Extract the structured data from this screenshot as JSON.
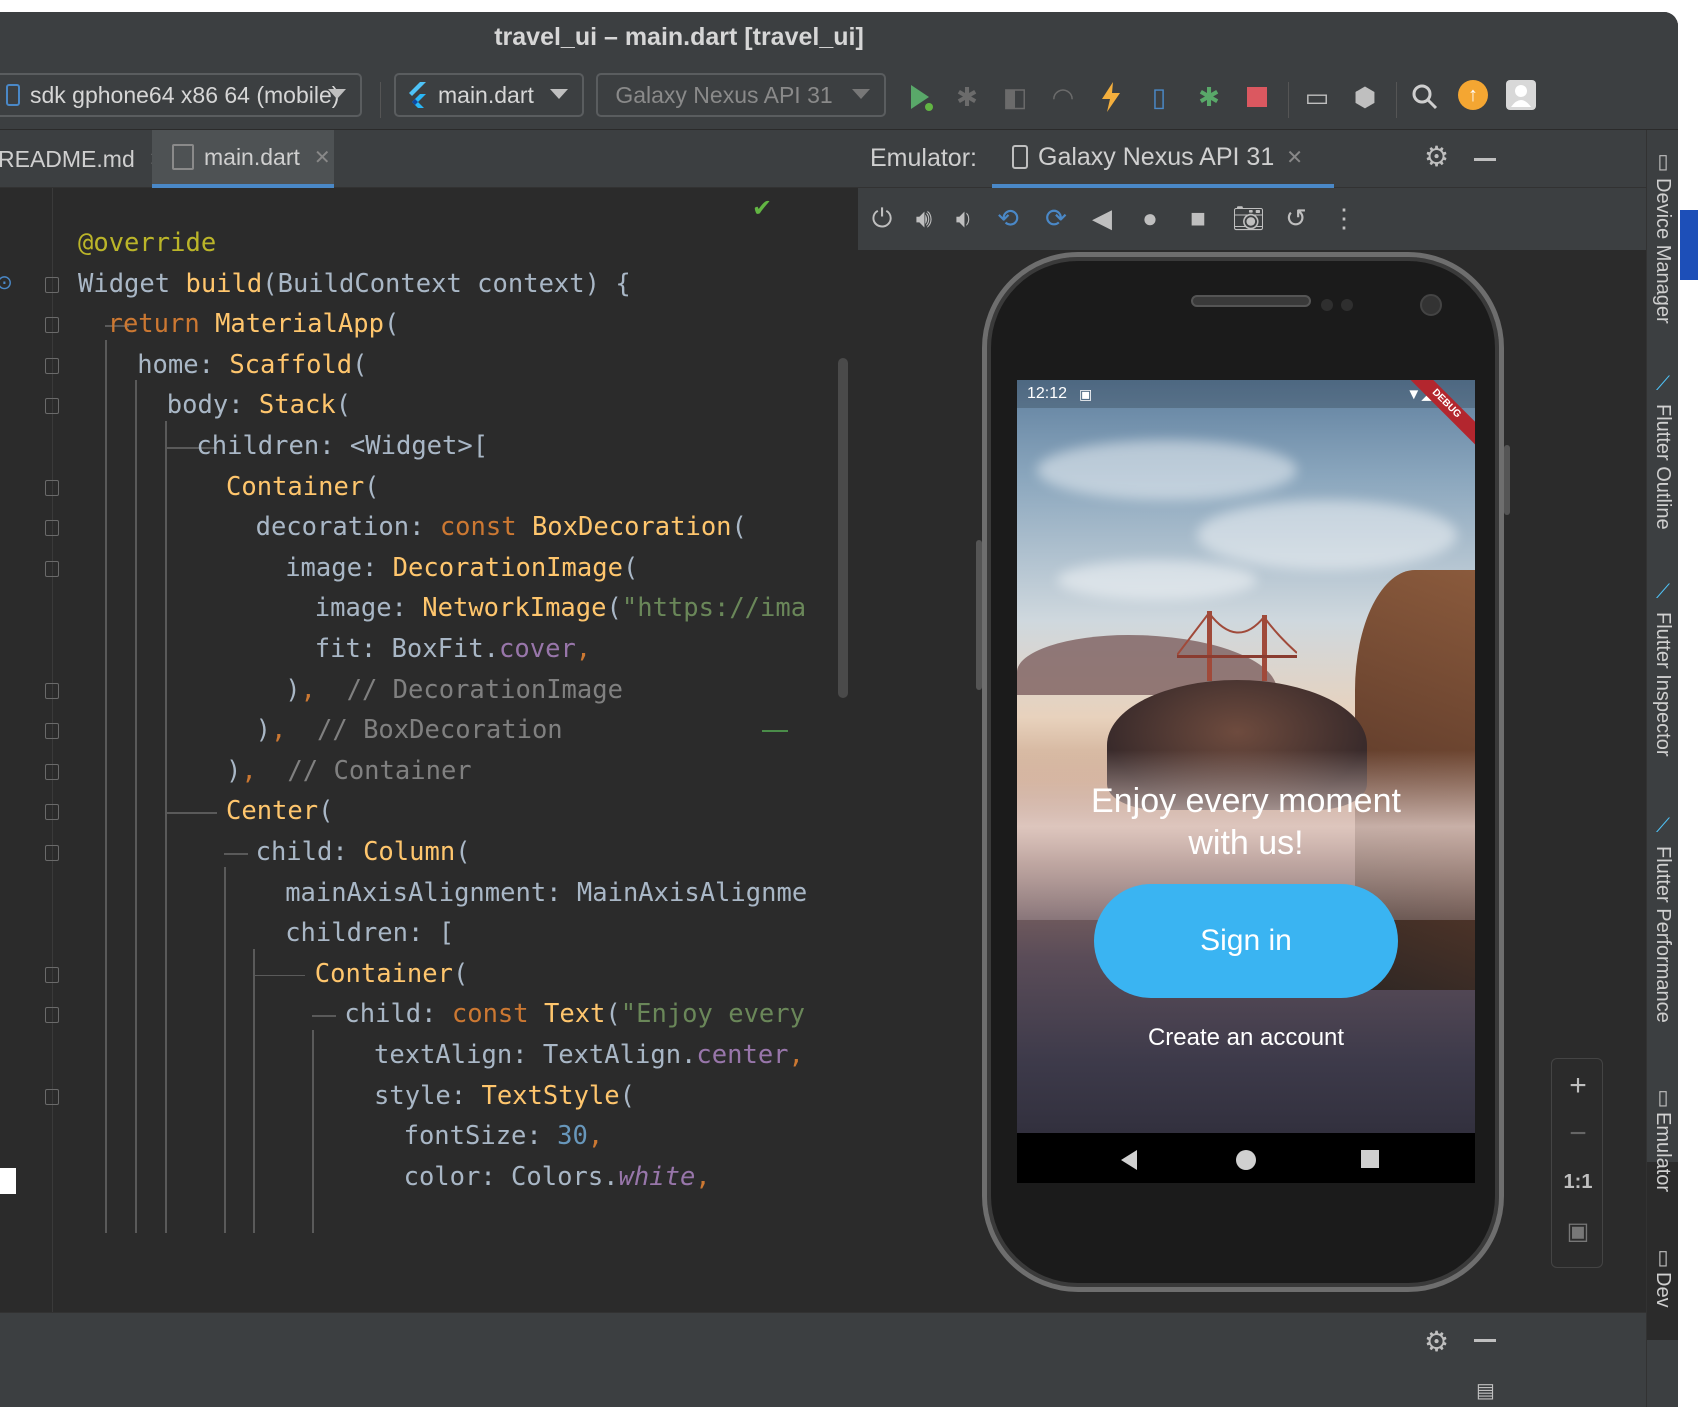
{
  "window": {
    "title": "travel_ui – main.dart [travel_ui]"
  },
  "toolbar": {
    "device_selector": "sdk gphone64 x86 64 (mobile)",
    "run_config": "main.dart",
    "target_device": "Galaxy Nexus API 31"
  },
  "editor_tabs": [
    {
      "label": "README.md",
      "active": false
    },
    {
      "label": "main.dart",
      "active": true
    }
  ],
  "code": {
    "lines": [
      {
        "indent": 0,
        "tokens": [
          [
            "ann",
            "@override"
          ]
        ]
      },
      {
        "indent": 0,
        "tokens": [
          [
            "txt",
            "Widget "
          ],
          [
            "cls",
            "build"
          ],
          [
            "txt",
            "(BuildContext context) {"
          ]
        ]
      },
      {
        "indent": 1,
        "tokens": [
          [
            "kw",
            "return "
          ],
          [
            "cls",
            "MaterialApp"
          ],
          [
            "txt",
            "("
          ]
        ]
      },
      {
        "indent": 2,
        "tokens": [
          [
            "txt",
            "home: "
          ],
          [
            "cls",
            "Scaffold"
          ],
          [
            "txt",
            "("
          ]
        ]
      },
      {
        "indent": 3,
        "tokens": [
          [
            "txt",
            "body: "
          ],
          [
            "cls",
            "Stack"
          ],
          [
            "txt",
            "("
          ]
        ]
      },
      {
        "indent": 4,
        "tokens": [
          [
            "txt",
            "children: <Widget>["
          ]
        ]
      },
      {
        "indent": 5,
        "tokens": [
          [
            "cls",
            "Container"
          ],
          [
            "txt",
            "("
          ]
        ]
      },
      {
        "indent": 6,
        "tokens": [
          [
            "txt",
            "decoration: "
          ],
          [
            "kw",
            "const "
          ],
          [
            "cls",
            "BoxDecoration"
          ],
          [
            "txt",
            "("
          ]
        ]
      },
      {
        "indent": 7,
        "tokens": [
          [
            "txt",
            "image: "
          ],
          [
            "cls",
            "DecorationImage"
          ],
          [
            "txt",
            "("
          ]
        ]
      },
      {
        "indent": 8,
        "tokens": [
          [
            "txt",
            "image: "
          ],
          [
            "cls",
            "NetworkImage"
          ],
          [
            "txt",
            "("
          ],
          [
            "str",
            "\"https://ima"
          ]
        ]
      },
      {
        "indent": 8,
        "tokens": [
          [
            "txt",
            "fit: BoxFit."
          ],
          [
            "fld",
            "cover"
          ],
          [
            "kw",
            ","
          ]
        ]
      },
      {
        "indent": 7,
        "tokens": [
          [
            "txt",
            ")"
          ],
          [
            "kw",
            ","
          ],
          [
            "cmt",
            "  // DecorationImage"
          ]
        ]
      },
      {
        "indent": 6,
        "tokens": [
          [
            "txt",
            ")"
          ],
          [
            "kw",
            ","
          ],
          [
            "cmt",
            "  // BoxDecoration"
          ]
        ]
      },
      {
        "indent": 5,
        "tokens": [
          [
            "txt",
            ")"
          ],
          [
            "kw",
            ","
          ],
          [
            "cmt",
            "  // Container"
          ]
        ]
      },
      {
        "indent": 5,
        "tokens": [
          [
            "cls",
            "Center"
          ],
          [
            "txt",
            "("
          ]
        ]
      },
      {
        "indent": 6,
        "tokens": [
          [
            "txt",
            "child: "
          ],
          [
            "cls",
            "Column"
          ],
          [
            "txt",
            "("
          ]
        ]
      },
      {
        "indent": 7,
        "tokens": [
          [
            "txt",
            "mainAxisAlignment: MainAxisAlignme"
          ]
        ]
      },
      {
        "indent": 7,
        "tokens": [
          [
            "txt",
            "children: ["
          ]
        ]
      },
      {
        "indent": 8,
        "tokens": [
          [
            "cls",
            "Container"
          ],
          [
            "txt",
            "("
          ]
        ]
      },
      {
        "indent": 9,
        "tokens": [
          [
            "txt",
            "child: "
          ],
          [
            "kw",
            "const "
          ],
          [
            "cls",
            "Text"
          ],
          [
            "txt",
            "("
          ],
          [
            "str",
            "\"Enjoy every"
          ]
        ]
      },
      {
        "indent": 10,
        "tokens": [
          [
            "txt",
            "textAlign: TextAlign."
          ],
          [
            "fld",
            "center"
          ],
          [
            "kw",
            ","
          ]
        ]
      },
      {
        "indent": 10,
        "tokens": [
          [
            "txt",
            "style: "
          ],
          [
            "cls",
            "TextStyle"
          ],
          [
            "txt",
            "("
          ]
        ]
      },
      {
        "indent": 11,
        "tokens": [
          [
            "txt",
            "fontSize: "
          ],
          [
            "num",
            "30"
          ],
          [
            "kw",
            ","
          ]
        ]
      },
      {
        "indent": 11,
        "tokens": [
          [
            "txt",
            "color: Colors."
          ],
          [
            "ital",
            "white"
          ],
          [
            "kw",
            ","
          ]
        ]
      }
    ]
  },
  "emulator": {
    "label": "Emulator:",
    "tab_label": "Galaxy Nexus API 31",
    "zoom_one_to_one": "1:1"
  },
  "phone_app": {
    "status_time": "12:12",
    "debug_banner": "DEBUG",
    "headline": "Enjoy every moment with us!",
    "signin_label": "Sign in",
    "create_account_label": "Create an account"
  },
  "right_tool_windows": [
    {
      "label": "Device Manager"
    },
    {
      "label": "Flutter Outline"
    },
    {
      "label": "Flutter Inspector"
    },
    {
      "label": "Flutter Performance"
    },
    {
      "label": "Emulator"
    },
    {
      "label": "Dev"
    }
  ],
  "colors": {
    "accent_blue": "#3ab4f2",
    "run_green": "#59a869",
    "stop_red": "#db5860",
    "lightning": "#f4af3d",
    "check_green": "#62b543"
  }
}
